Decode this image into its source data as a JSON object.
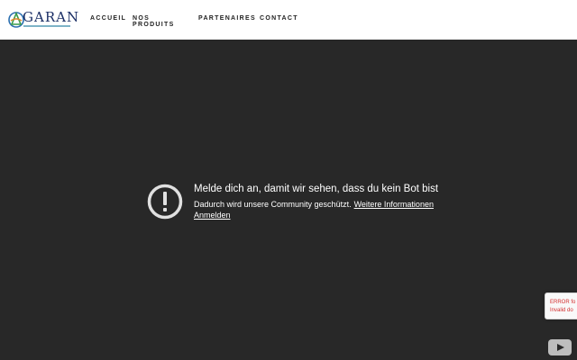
{
  "header": {
    "logo_text": "GARAN",
    "nav": [
      {
        "label": "ACCUEIL"
      },
      {
        "label": "NOS PRODUITS"
      },
      {
        "label": "PARTENAIRES"
      },
      {
        "label": "CONTACT"
      }
    ]
  },
  "player": {
    "message_title": "Melde dich an, damit wir sehen, dass du kein Bot bist",
    "message_body": "Dadurch wird unsere Community geschützt.",
    "more_info_link": "Weitere Informationen",
    "sign_in_link": "Anmelden",
    "alert_icon": "alert-circle-icon",
    "brand_icon": "youtube-logo-icon"
  },
  "recaptcha": {
    "line1": "ERROR fo",
    "line2": "Invalid do"
  },
  "colors": {
    "player_bg": "#282828",
    "logo_blue": "#1b2f66",
    "error_red": "#d32f2f"
  }
}
